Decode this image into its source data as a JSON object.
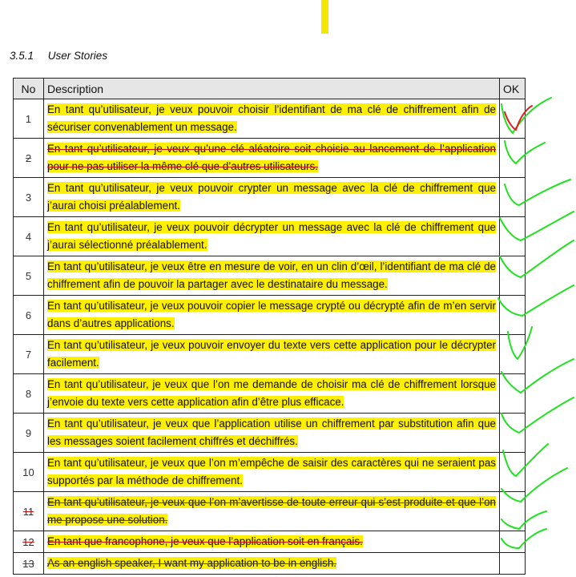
{
  "section": {
    "number": "3.5.1",
    "title": "User Stories"
  },
  "table": {
    "headers": {
      "no": "No",
      "description": "Description",
      "ok": "OK"
    },
    "rows": [
      {
        "no": "1",
        "text": "En tant qu’utilisateur, je veux pouvoir choisir l’identifiant de ma clé de chiffrement afin de sécuriser convenablement un message.",
        "struck": false
      },
      {
        "no": "2",
        "text": "En tant qu’utilisateur, je veux qu’une clé aléatoire soit choisie au lancement de l’application pour ne pas utiliser la même clé que d’autres utilisateurs.",
        "struck": true
      },
      {
        "no": "3",
        "text": "En tant qu’utilisateur, je veux pouvoir crypter un message avec la clé de chiffrement que j’aurai choisi préalablement.",
        "struck": false
      },
      {
        "no": "4",
        "text": "En tant qu’utilisateur, je veux pouvoir décrypter un message avec la clé de chiffrement que j’aurai sélectionné préalablement.",
        "struck": false
      },
      {
        "no": "5",
        "text": "En tant qu’utilisateur, je veux être en mesure de voir, en un clin d’œil, l’identifiant de ma clé de chiffrement afin de pouvoir la partager avec le destinataire du message.",
        "struck": false
      },
      {
        "no": "6",
        "text": "En tant qu’utilisateur, je veux pouvoir copier le message crypté ou décrypté afin de m’en servir dans d’autres applications.",
        "struck": false
      },
      {
        "no": "7",
        "text": "En tant qu’utilisateur, je veux pouvoir envoyer du texte vers cette application pour le décrypter facilement.",
        "struck": false
      },
      {
        "no": "8",
        "text": "En tant qu’utilisateur, je veux que l’on me demande de choisir ma clé de chiffrement lorsque j’envoie du texte vers cette application afin d’être plus efficace.",
        "struck": false
      },
      {
        "no": "9",
        "text": "En tant qu’utilisateur, je veux que l’application utilise un chiffrement par substitution afin que les messages soient facilement chiffrés et déchiffrés.",
        "struck": false
      },
      {
        "no": "10",
        "text": "En tant qu’utilisateur, je veux que l’on m’empêche de saisir des caractères qui ne seraient pas supportés par la méthode de chiffrement.",
        "struck": false
      },
      {
        "no": "11",
        "text": "En tant qu’utilisateur, je veux que l’on m’avertisse de toute erreur qui s’est produite et que l’on me propose une solution.",
        "struck": true
      },
      {
        "no": "12",
        "text": "En tant que francophone, je veux que l’application soit en français.",
        "struck": true
      },
      {
        "no": "13",
        "text": "As an english speaker, I want my application to be in english.",
        "struck": true
      }
    ]
  },
  "colors": {
    "highlight": "#ffef00",
    "strike": "#d21010",
    "check_green": "#22e022",
    "check_red": "#e02020"
  }
}
